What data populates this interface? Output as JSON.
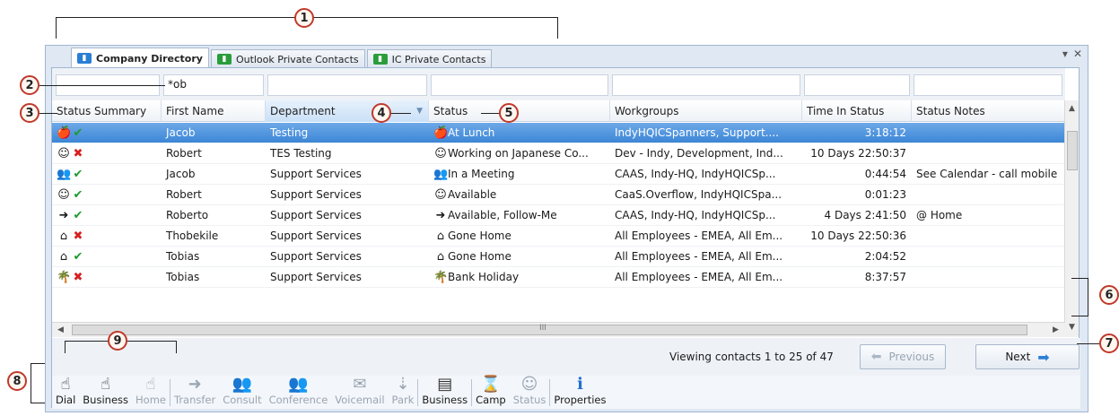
{
  "callouts": [
    "1",
    "2",
    "3",
    "4",
    "5",
    "6",
    "7",
    "8",
    "9"
  ],
  "window": {
    "controls": [
      "▾",
      "✕"
    ]
  },
  "tabs": [
    {
      "label": "Company Directory",
      "icon": "directory-icon",
      "color": "#2a7fd4"
    },
    {
      "label": "Outlook Private Contacts",
      "icon": "outlook-contacts-icon",
      "color": "#2a9d3a"
    },
    {
      "label": "IC Private Contacts",
      "icon": "ic-contacts-icon",
      "color": "#2a9d3a"
    }
  ],
  "filters": {
    "first_name": "*ob"
  },
  "columns": [
    "Status Summary",
    "First Name",
    "Department",
    "Status",
    "Workgroups",
    "Time In Status",
    "Status Notes"
  ],
  "rows": [
    {
      "summary_icon": "lunch-icon",
      "summary_glyph": "🍎",
      "ok": true,
      "first": "Jacob",
      "dept": "Testing",
      "status_glyph": "🍎",
      "status": "At Lunch",
      "workgroups": "IndyHQICSpanners, Support....",
      "time": "3:18:12",
      "notes": "",
      "selected": true
    },
    {
      "summary_icon": "available-icon",
      "summary_glyph": "☺",
      "ok": false,
      "first": "Robert",
      "dept": "TES Testing",
      "status_glyph": "☺",
      "status": "Working on Japanese Co...",
      "workgroups": "Dev - Indy, Development, Ind...",
      "time": "10 Days 22:50:37",
      "notes": ""
    },
    {
      "summary_icon": "meeting-icon",
      "summary_glyph": "👥",
      "ok": true,
      "first": "Jacob",
      "dept": "Support Services",
      "status_glyph": "👥",
      "status": "In a Meeting",
      "workgroups": "CAAS, Indy-HQ, IndyHQICSp...",
      "time": "0:44:54",
      "notes": "See Calendar - call mobile"
    },
    {
      "summary_icon": "available-icon",
      "summary_glyph": "☺",
      "ok": true,
      "first": "Robert",
      "dept": "Support Services",
      "status_glyph": "☺",
      "status": "Available",
      "workgroups": "CaaS.Overflow, IndyHQICSpa...",
      "time": "0:01:23",
      "notes": ""
    },
    {
      "summary_icon": "follow-me-icon",
      "summary_glyph": "➜",
      "ok": true,
      "first": "Roberto",
      "dept": "Support Services",
      "status_glyph": "➜",
      "status": "Available, Follow-Me",
      "workgroups": "CAAS, Indy-HQ, IndyHQICSp...",
      "time": "4 Days 2:41:50",
      "notes": "@ Home"
    },
    {
      "summary_icon": "home-icon",
      "summary_glyph": "⌂",
      "ok": false,
      "first": "Thobekile",
      "dept": "Support Services",
      "status_glyph": "⌂",
      "status": "Gone Home",
      "workgroups": "All Employees - EMEA, All Em...",
      "time": "10 Days 22:50:36",
      "notes": ""
    },
    {
      "summary_icon": "home-icon",
      "summary_glyph": "⌂",
      "ok": true,
      "first": "Tobias",
      "dept": "Support Services",
      "status_glyph": "⌂",
      "status": "Gone Home",
      "workgroups": "All Employees - EMEA, All Em...",
      "time": "2:04:52",
      "notes": ""
    },
    {
      "summary_icon": "holiday-icon",
      "summary_glyph": "🌴",
      "ok": false,
      "first": "Tobias",
      "dept": "Support Services",
      "status_glyph": "🌴",
      "status": "Bank Holiday",
      "workgroups": "All Employees - EMEA, All Em...",
      "time": "8:37:57",
      "notes": ""
    }
  ],
  "scroll_h_label": "III",
  "pager": {
    "text": "Viewing contacts 1 to 25 of 47",
    "previous": "Previous",
    "next": "Next"
  },
  "toolbar": [
    {
      "label": "Dial",
      "icon": "dial-icon",
      "glyph": "☝",
      "enabled": true
    },
    {
      "label": "Business",
      "icon": "business-dial-icon",
      "glyph": "☝",
      "enabled": true
    },
    {
      "label": "Home",
      "icon": "home-dial-icon",
      "glyph": "☝",
      "enabled": false
    },
    {
      "sep": true
    },
    {
      "label": "Transfer",
      "icon": "transfer-icon",
      "glyph": "➜",
      "enabled": false
    },
    {
      "label": "Consult",
      "icon": "consult-icon",
      "glyph": "👥",
      "enabled": false
    },
    {
      "label": "Conference",
      "icon": "conference-icon",
      "glyph": "👥",
      "enabled": false
    },
    {
      "label": "Voicemail",
      "icon": "voicemail-icon",
      "glyph": "✉",
      "enabled": false
    },
    {
      "label": "Park",
      "icon": "park-icon",
      "glyph": "⇣",
      "enabled": false
    },
    {
      "sep": true
    },
    {
      "label": "Business",
      "icon": "business-card-icon",
      "glyph": "▤",
      "enabled": true
    },
    {
      "sep": true
    },
    {
      "label": "Camp",
      "icon": "camp-icon",
      "glyph": "⌛",
      "enabled": true
    },
    {
      "label": "Status",
      "icon": "status-icon",
      "glyph": "☺",
      "enabled": false
    },
    {
      "sep": true
    },
    {
      "label": "Properties",
      "icon": "properties-icon",
      "glyph": "ℹ",
      "enabled": true
    }
  ]
}
